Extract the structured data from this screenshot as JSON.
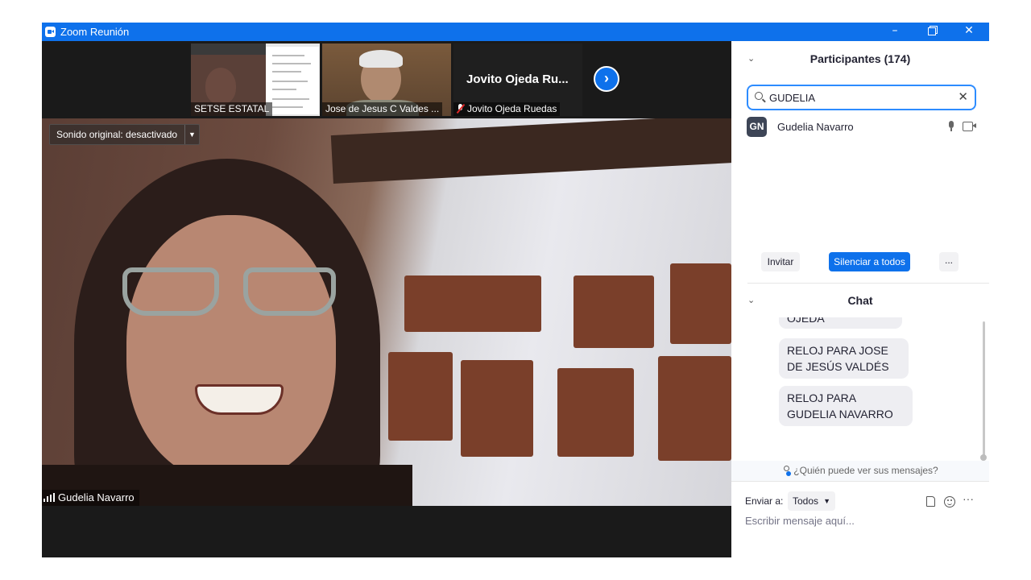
{
  "window": {
    "title": "Zoom Reunión",
    "controls": {
      "minimize": "–",
      "close": "✕"
    }
  },
  "video": {
    "thumbnails": [
      {
        "name": "SETSE ESTATAL",
        "muted": false
      },
      {
        "name": "Jose de Jesus C Valdes ...",
        "muted": false
      },
      {
        "name": "Jovito Ojeda Ruedas",
        "display_name": "Jovito Ojeda Ru...",
        "muted": true
      }
    ],
    "next_arrow": "›",
    "audio_dropdown": {
      "label": "Sonido original: desactivado",
      "caret": "▼"
    },
    "active_speaker": "Gudelia Navarro"
  },
  "participants": {
    "header": "Participantes (174)",
    "collapse_icon": "chevron-down-icon",
    "search": {
      "value": "GUDELIA",
      "clear": "✕"
    },
    "items": [
      {
        "initials": "GN",
        "name": "Gudelia Navarro",
        "mic": "mic-icon",
        "video": "camera-icon"
      }
    ],
    "buttons": {
      "invite": "Invitar",
      "mute_all": "Silenciar a todos",
      "more": "..."
    }
  },
  "chat": {
    "header": "Chat",
    "messages": [
      "OJEDA",
      "RELOJ PARA JOSE DE JESÚS VALDÉS",
      "RELOJ PARA GUDELIA NAVARRO"
    ],
    "who_can_see": "¿Quién puede ver sus mensajes?",
    "send_to_label": "Enviar a:",
    "send_to_value": "Todos",
    "input_placeholder": "Escribir mensaje aquí...",
    "more": "···"
  },
  "colors": {
    "accent": "#0e71eb",
    "titlebar": "#0e71eb",
    "video_bg": "#1a1a1a"
  }
}
